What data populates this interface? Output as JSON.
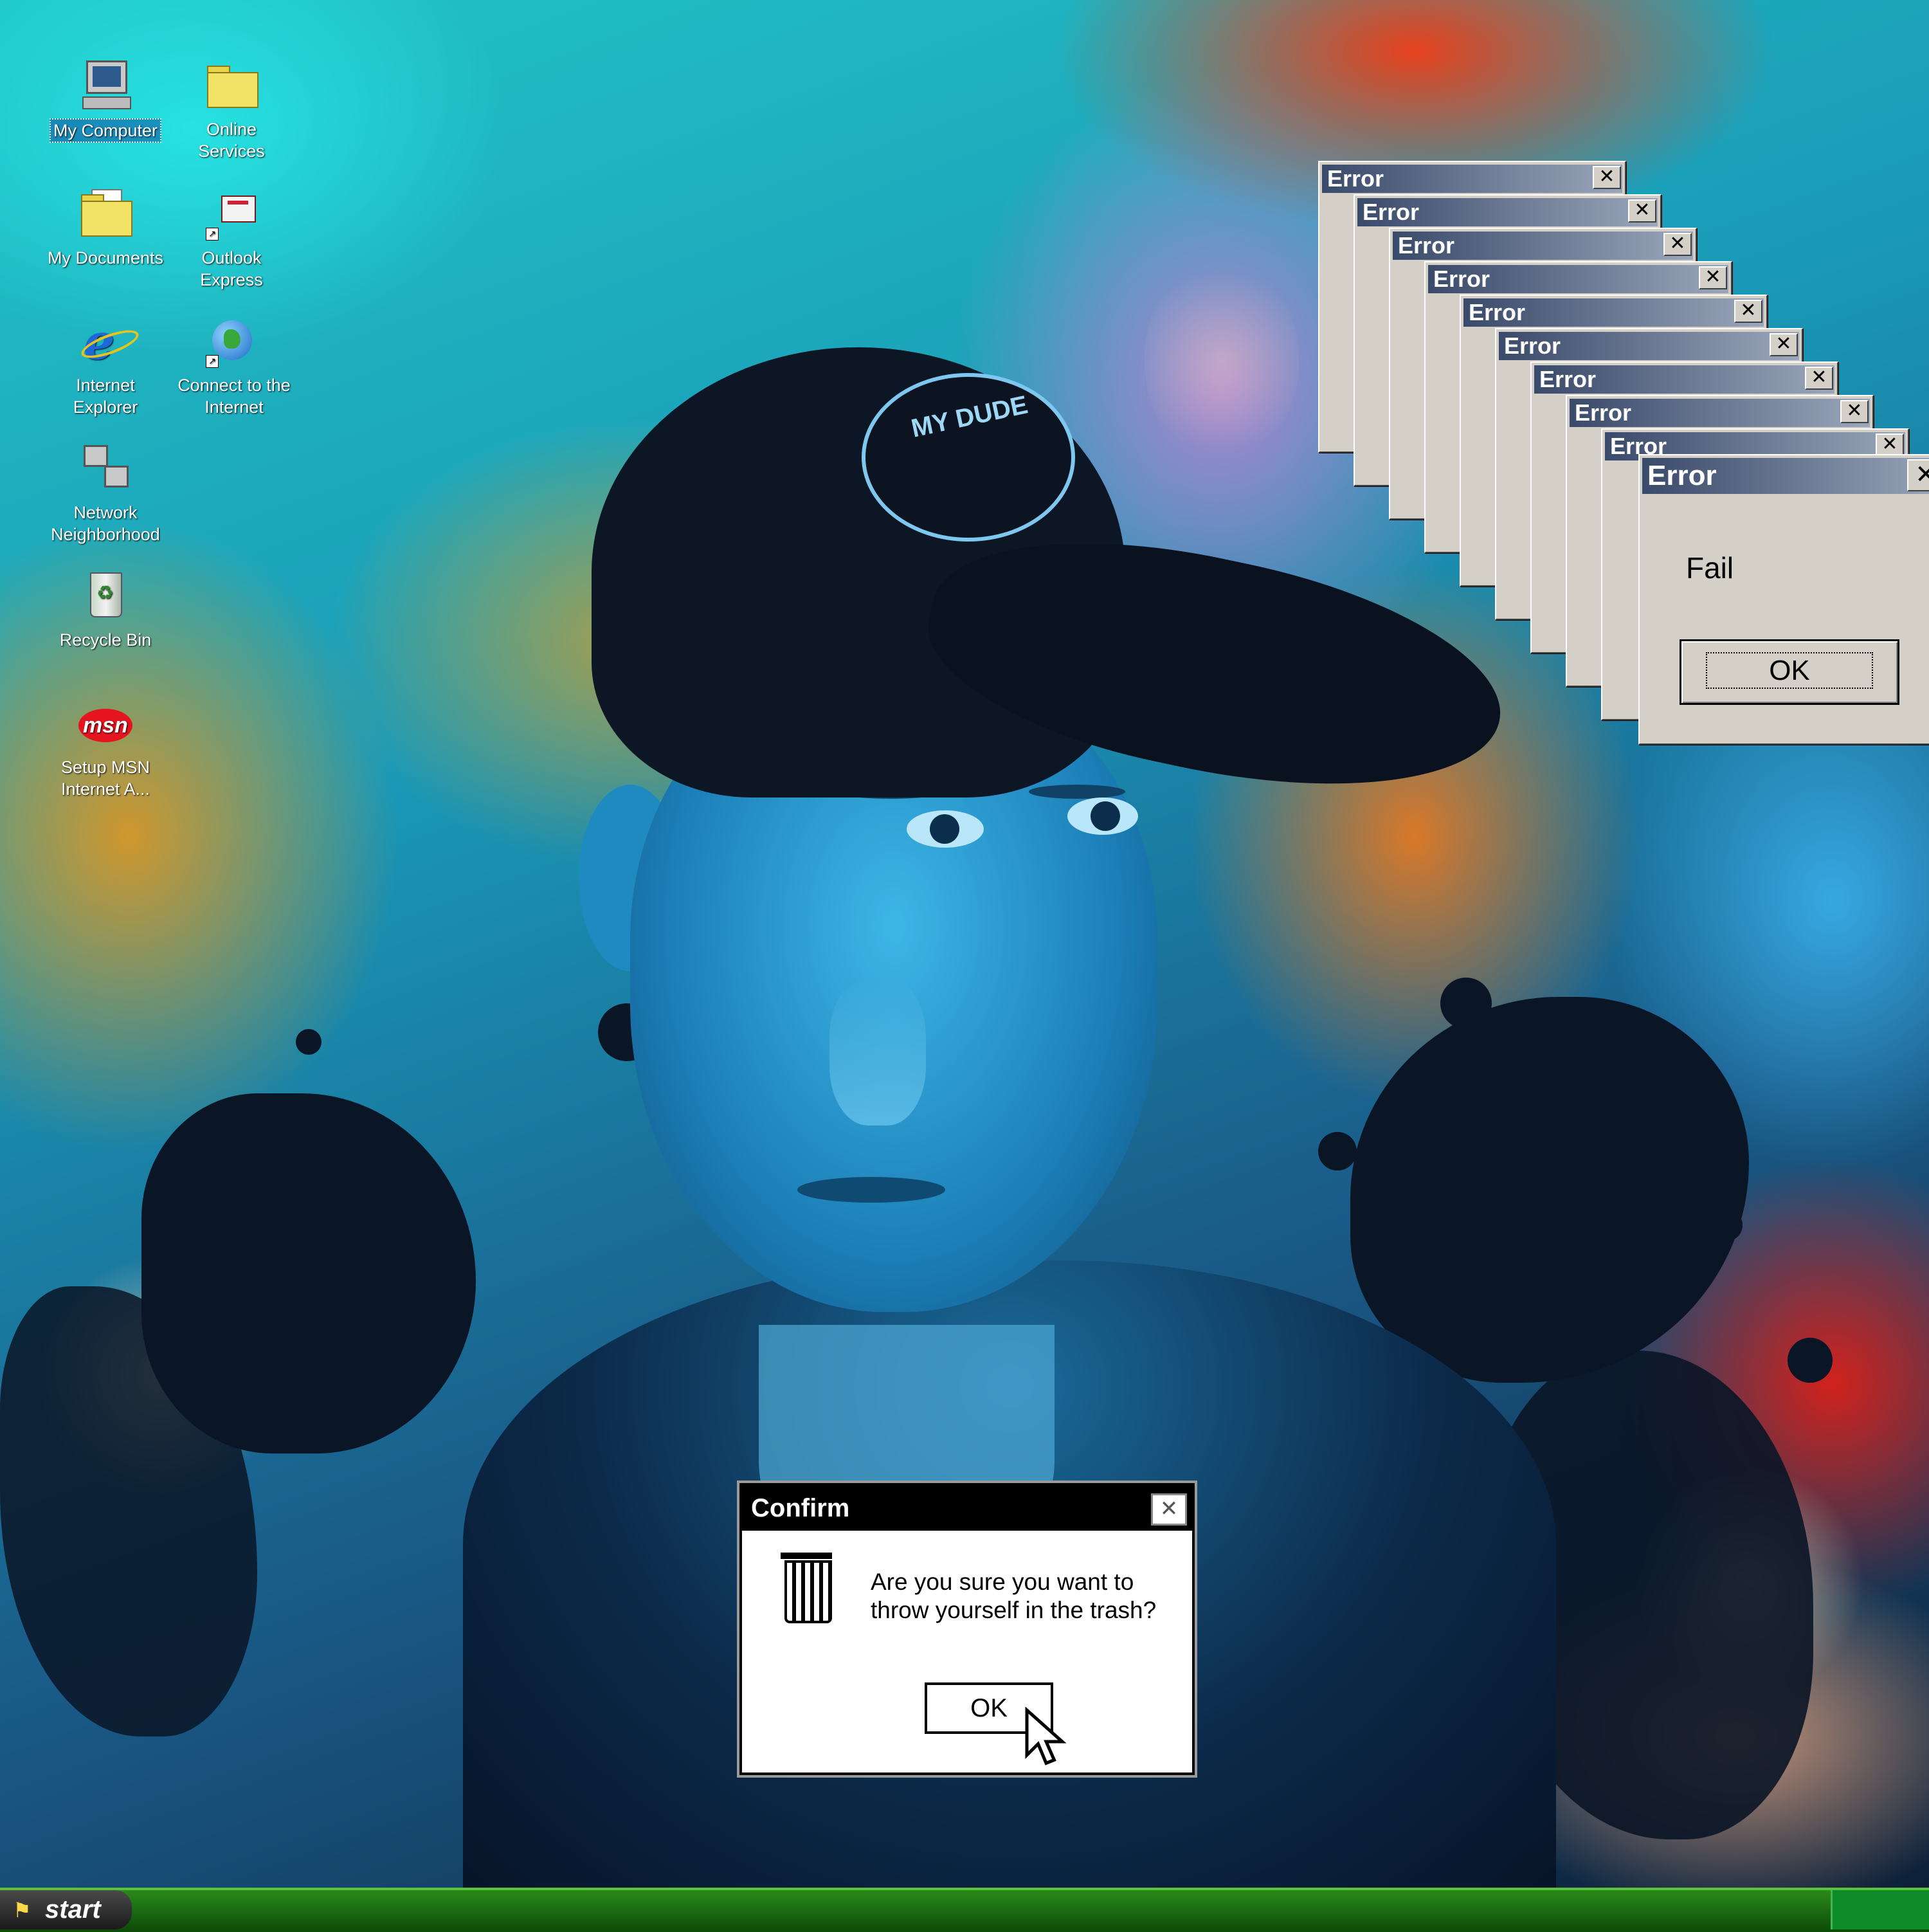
{
  "desktop": {
    "icons": [
      {
        "label": "My Computer",
        "icon": "my-computer-icon",
        "selected": true
      },
      {
        "label": "Online Services",
        "icon": "folder-icon"
      },
      {
        "label": "My Documents",
        "icon": "my-documents-icon"
      },
      {
        "label": "Outlook Express",
        "icon": "outlook-express-icon"
      },
      {
        "label": "Internet Explorer",
        "icon": "internet-explorer-icon"
      },
      {
        "label": "Connect to the Internet",
        "icon": "connect-internet-icon"
      },
      {
        "label": "Network Neighborhood",
        "icon": "network-neighborhood-icon"
      },
      {
        "label": "Recycle Bin",
        "icon": "recycle-bin-icon"
      },
      {
        "label": "Setup MSN Internet A...",
        "icon": "msn-icon"
      }
    ],
    "msn_logo_text": "msn",
    "cap_patch_text": "MY DUDE"
  },
  "error_stack": {
    "stacked_title": "Error",
    "count": 10
  },
  "error_dialog": {
    "title": "Error",
    "message": "Fail",
    "ok_label": "OK",
    "close_glyph": "✕"
  },
  "confirm_dialog": {
    "title": "Confirm",
    "message_line1": "Are you sure you want to",
    "message_line2": "throw yourself in the trash?",
    "ok_label": "OK",
    "close_glyph": "✕"
  },
  "taskbar": {
    "start_label": "start",
    "start_flag_glyph": "⚑"
  },
  "colors": {
    "title_bar_dark": "#3a4a6a",
    "window_gray": "#d4d0c8",
    "taskbar_green": "#2a8a1a"
  }
}
